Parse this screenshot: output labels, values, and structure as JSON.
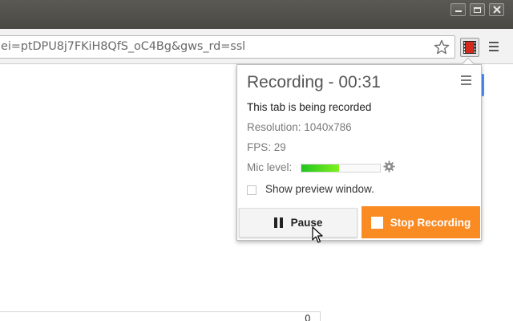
{
  "browser": {
    "url": "ei=ptDPU8j7FKiH8QfS_oC4Bg&gws_rd=ssl",
    "icons": {
      "minimize": "minimize-icon",
      "maximize": "maximize-icon",
      "close": "close-icon",
      "bookmark": "star-icon",
      "extension": "film-record-icon",
      "menu": "hamburger-menu-icon"
    }
  },
  "page": {
    "number": "0"
  },
  "popup": {
    "title": "Recording - 00:31",
    "status": "This tab is being recorded",
    "resolution": "Resolution: 1040x786",
    "fps": "FPS: 29",
    "mic_label": "Mic level:",
    "mic_level_fraction": 0.48,
    "show_preview_label": "Show preview window.",
    "show_preview_checked": false,
    "pause_label": "Pause",
    "stop_label": "Stop Recording",
    "colors": {
      "stop_button": "#fa8a22",
      "mic_meter": "#3ed21e"
    }
  }
}
